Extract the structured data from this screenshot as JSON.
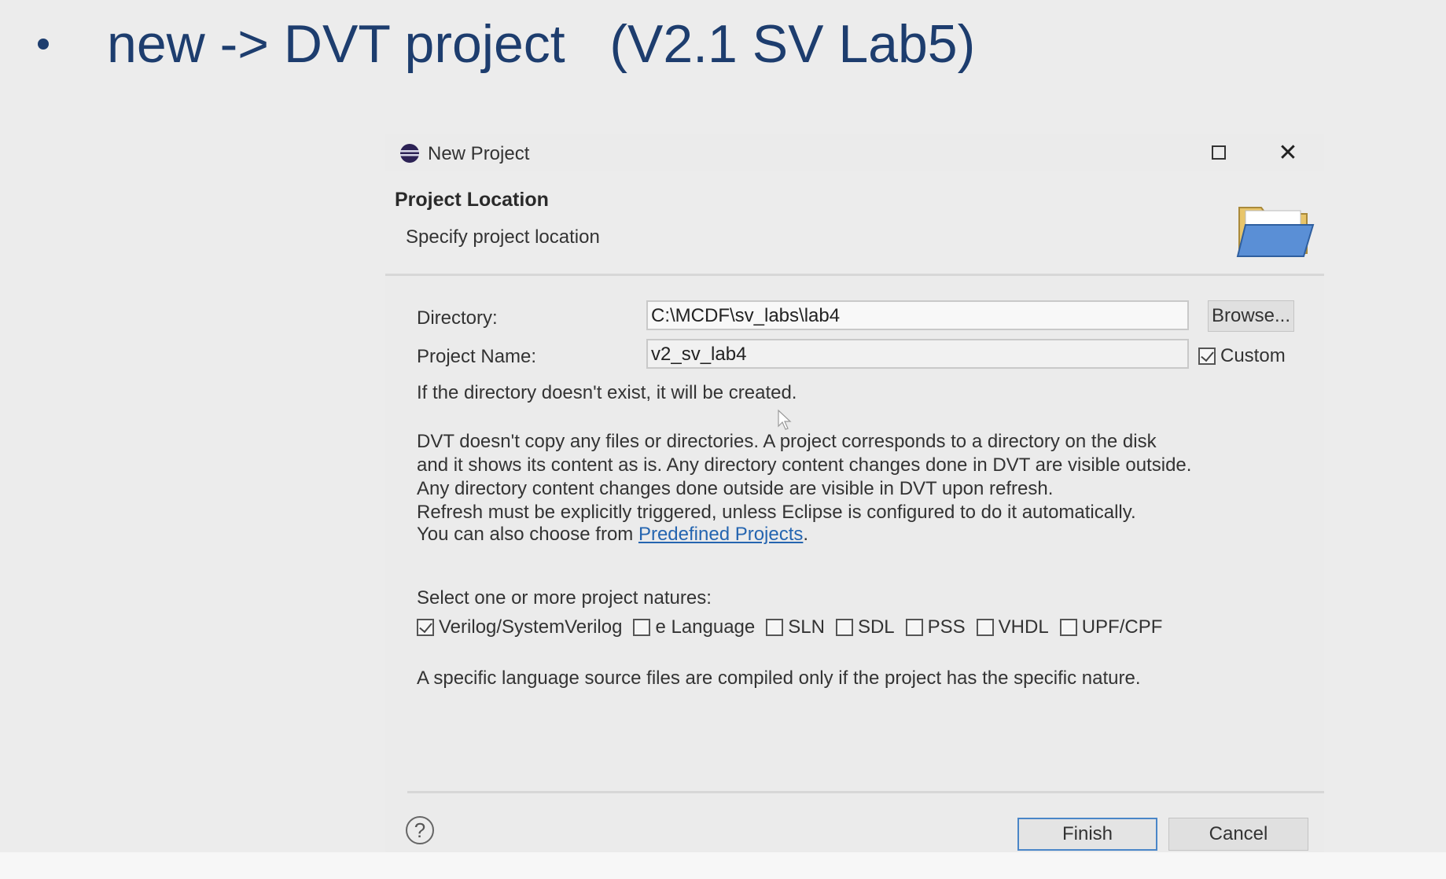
{
  "slide": {
    "title": "new -> DVT project   (V2.1 SV Lab5)"
  },
  "dialog": {
    "title": "New Project",
    "header": {
      "title": "Project Location",
      "subtitle": "Specify project location"
    },
    "directory": {
      "label": "Directory:",
      "value": "C:\\MCDF\\sv_labs\\lab4",
      "browse_label": "Browse..."
    },
    "project_name": {
      "label": "Project Name:",
      "value": "v2_sv_lab4",
      "custom_label": "Custom",
      "custom_checked": true
    },
    "note": "If the directory doesn't exist, it will be created.",
    "info_lines": [
      "DVT doesn't copy any files or directories. A project corresponds to a directory on the disk",
      "and it shows its content as is. Any directory content changes done in DVT are visible outside.",
      "Any directory content changes done outside are visible in DVT upon refresh.",
      "Refresh must be explicitly triggered, unless Eclipse is configured to do it automatically."
    ],
    "predefined": {
      "prefix": "You can also choose from ",
      "link": "Predefined Projects",
      "suffix": "."
    },
    "natures": {
      "label": "Select one or more project natures:",
      "items": [
        {
          "label": "Verilog/SystemVerilog",
          "checked": true
        },
        {
          "label": "e Language",
          "checked": false
        },
        {
          "label": "SLN",
          "checked": false
        },
        {
          "label": "SDL",
          "checked": false
        },
        {
          "label": "PSS",
          "checked": false
        },
        {
          "label": "VHDL",
          "checked": false
        },
        {
          "label": "UPF/CPF",
          "checked": false
        }
      ],
      "note": "A specific language source files are compiled only if the project has the specific nature."
    },
    "buttons": {
      "finish": "Finish",
      "cancel": "Cancel",
      "help": "?"
    },
    "window_controls": {
      "close": "✕"
    }
  }
}
